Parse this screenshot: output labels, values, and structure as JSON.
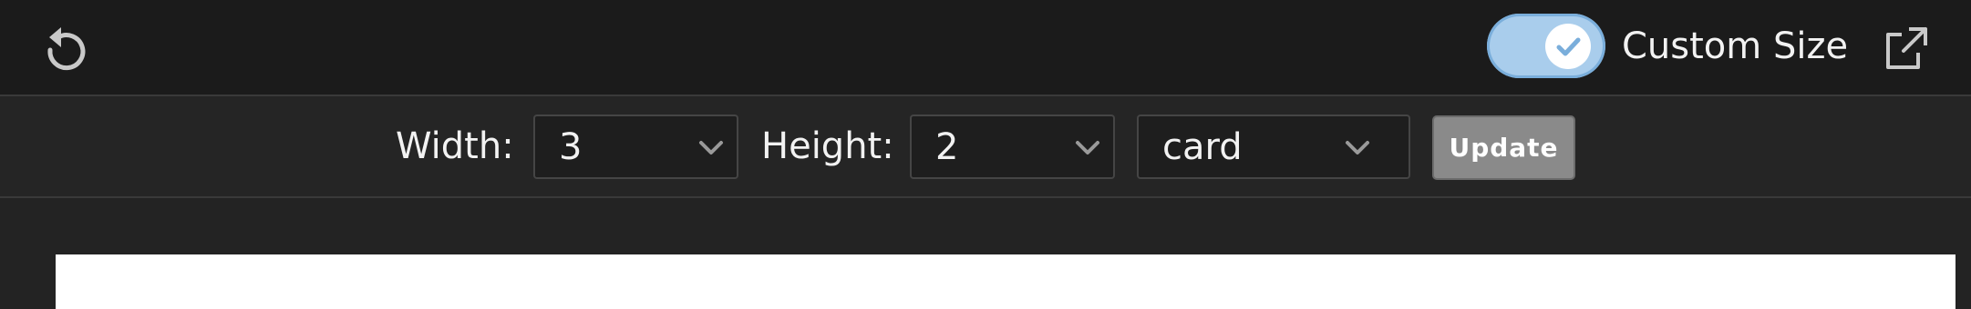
{
  "header": {
    "reload_icon": "reload-icon",
    "toggle": {
      "state": "on",
      "icon": "check-icon",
      "track_color": "#a9cdec",
      "check_color": "#7aaedb"
    },
    "custom_size_label": "Custom Size",
    "external_icon": "open-external-icon"
  },
  "toolbar": {
    "width_label": "Width:",
    "width_value": "3",
    "height_label": "Height:",
    "height_value": "2",
    "type_value": "card",
    "update_label": "Update",
    "update_color": "#8a8a8a"
  },
  "preview": {
    "background": "#ffffff"
  }
}
